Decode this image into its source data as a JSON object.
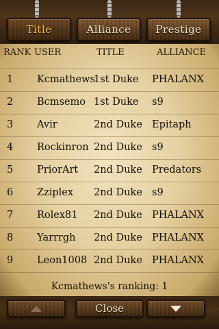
{
  "tabs": [
    {
      "label": "Title",
      "active": true
    },
    {
      "label": "Alliance",
      "active": false
    },
    {
      "label": "Prestige",
      "active": false
    }
  ],
  "header": {
    "rank": "RANK",
    "user": "USER",
    "title": "TITLE",
    "alliance": "ALLIANCE"
  },
  "rows": [
    {
      "rank": "1",
      "user": "Kcmathews",
      "title": "1st Duke",
      "alliance": "PHALANX"
    },
    {
      "rank": "2",
      "user": "Bcmsemo",
      "title": "1st Duke",
      "alliance": "s9"
    },
    {
      "rank": "3",
      "user": "Avir",
      "title": "2nd Duke",
      "alliance": "Epitaph"
    },
    {
      "rank": "4",
      "user": "Rockinron",
      "title": "2nd Duke",
      "alliance": "s9"
    },
    {
      "rank": "5",
      "user": "PriorArt",
      "title": "2nd Duke",
      "alliance": "Predators"
    },
    {
      "rank": "6",
      "user": "Zziplex",
      "title": "2nd Duke",
      "alliance": "s9"
    },
    {
      "rank": "7",
      "user": "Rolex81",
      "title": "2nd Duke",
      "alliance": "PHALANX"
    },
    {
      "rank": "8",
      "user": "Yarrrgh",
      "title": "2nd Duke",
      "alliance": "PHALANX"
    },
    {
      "rank": "9",
      "user": "Leon1008",
      "title": "2nd Duke",
      "alliance": "PHALANX"
    }
  ],
  "ranking_text": "Kcmathews's ranking: 1",
  "buttons": {
    "up_icon": "arrow-up-icon",
    "close_label": "Close",
    "down_icon": "arrow-down-icon"
  },
  "colors": {
    "active_tab": "#f3bd3a",
    "tab_text": "#f2e6cf"
  }
}
